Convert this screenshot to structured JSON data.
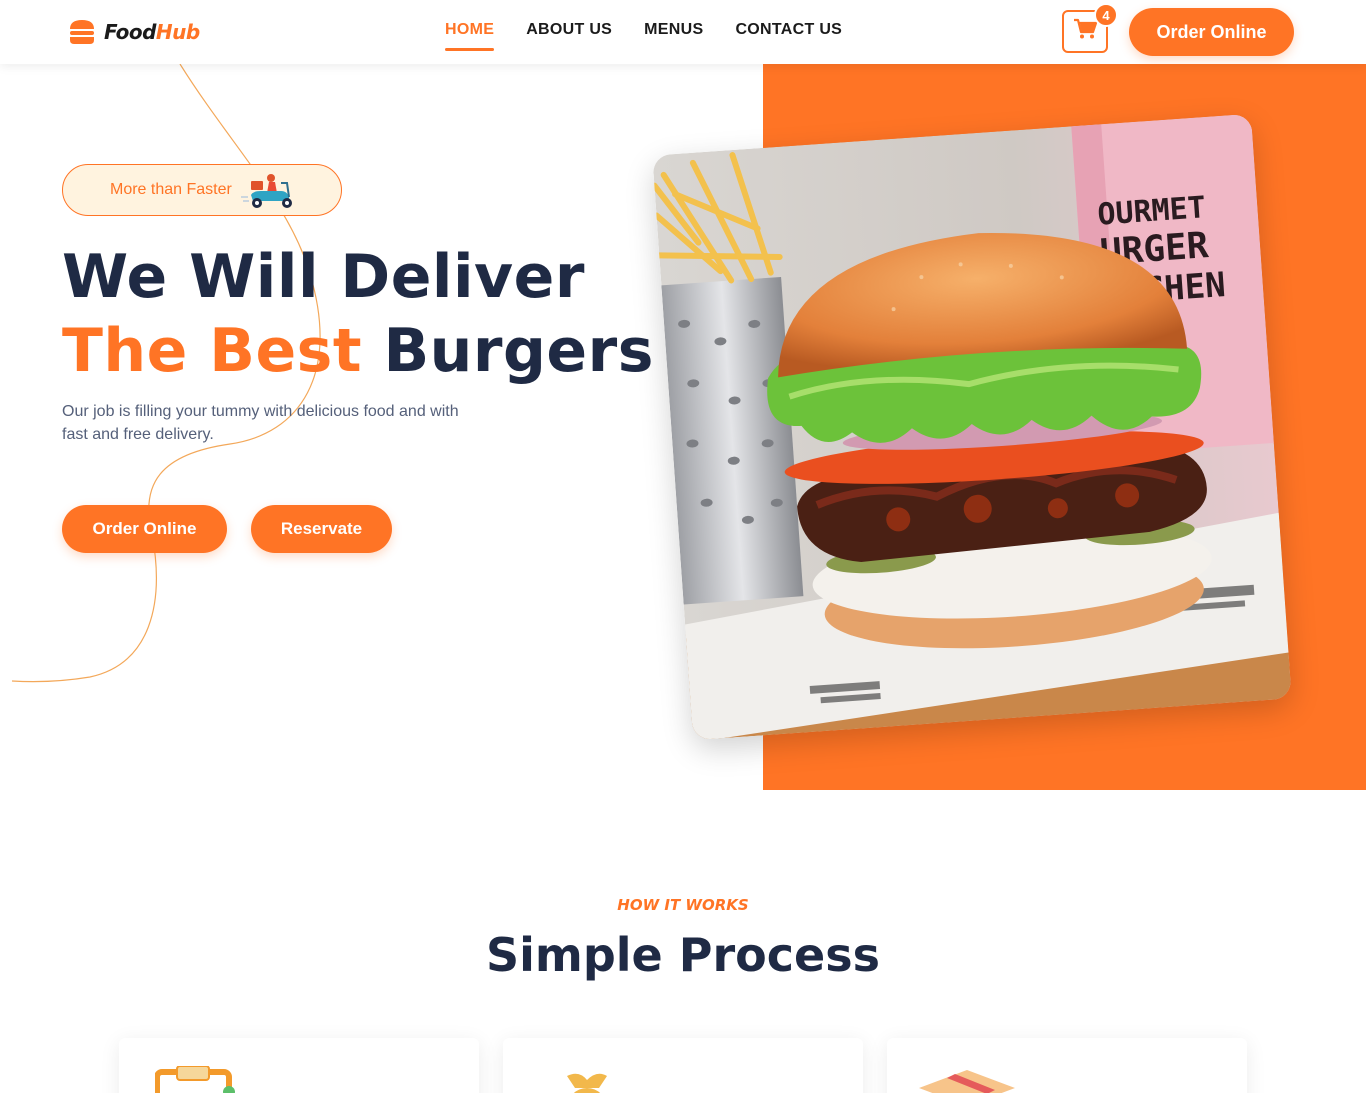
{
  "brand": {
    "name_a": "Food",
    "name_b": "Hub",
    "logo_icon": "burger-icon",
    "accent": "#ff7425",
    "dark": "#1f2a44"
  },
  "nav": {
    "items": [
      {
        "label": "HOME",
        "active": true
      },
      {
        "label": "ABOUT US",
        "active": false
      },
      {
        "label": "MENUS",
        "active": false
      },
      {
        "label": "CONTACT US",
        "active": false
      }
    ]
  },
  "cart": {
    "icon": "shopping-cart-icon",
    "count": "4"
  },
  "header_cta": "Order Online",
  "hero": {
    "badge": "More than Faster",
    "badge_icon": "delivery-scooter-icon",
    "title_line1": "We Will Deliver",
    "title_line2_highlight": "The Best",
    "title_line2_rest": "Burgers",
    "subtitle": "Our job is filling your tummy with delicious food and with fast and free delivery.",
    "btn_order": "Order Online",
    "btn_reserve": "Reservate",
    "photo_sign": [
      "OURMET",
      "URGER",
      "ITCHEN"
    ]
  },
  "process": {
    "eyebrow": "HOW IT WORKS",
    "title": "Simple Process",
    "card_icons": [
      "clipboard-icon",
      "money-bag-icon",
      "box-icon"
    ]
  }
}
